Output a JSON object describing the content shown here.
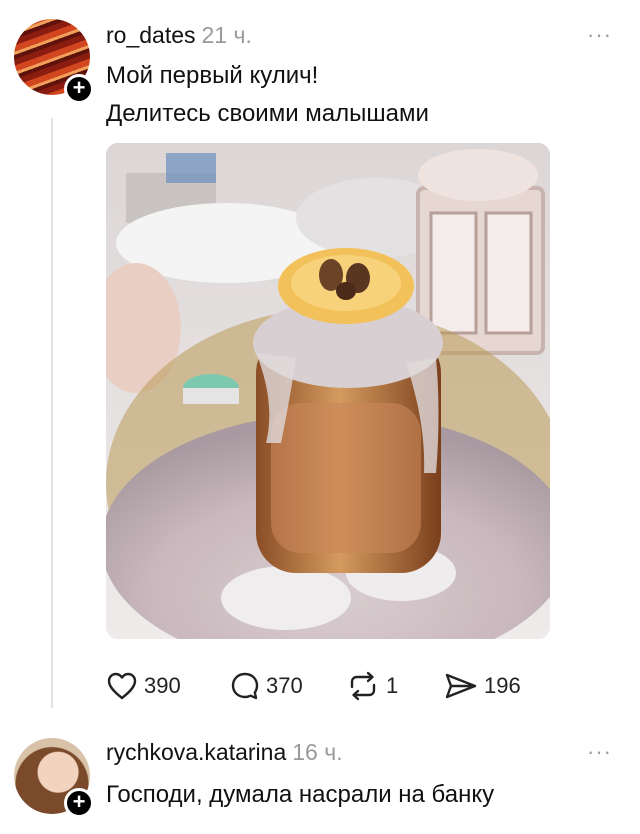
{
  "post": {
    "username": "ro_dates",
    "time": "21 ч.",
    "more": "···",
    "lines": [
      "Мой первый кулич!",
      "Делитесь своими малышами"
    ],
    "image_alt": "photo of homemade kulich",
    "actions": {
      "likes": "390",
      "comments": "370",
      "reposts": "1",
      "shares": "196"
    }
  },
  "reply": {
    "username": "rychkova.katarina",
    "time": "16 ч.",
    "more": "···",
    "text": "Господи, думала насрали на банку"
  },
  "icons": {
    "like": "heart-icon",
    "comment": "comment-bubble-icon",
    "repost": "repost-icon",
    "share": "send-icon",
    "follow": "plus-icon"
  }
}
